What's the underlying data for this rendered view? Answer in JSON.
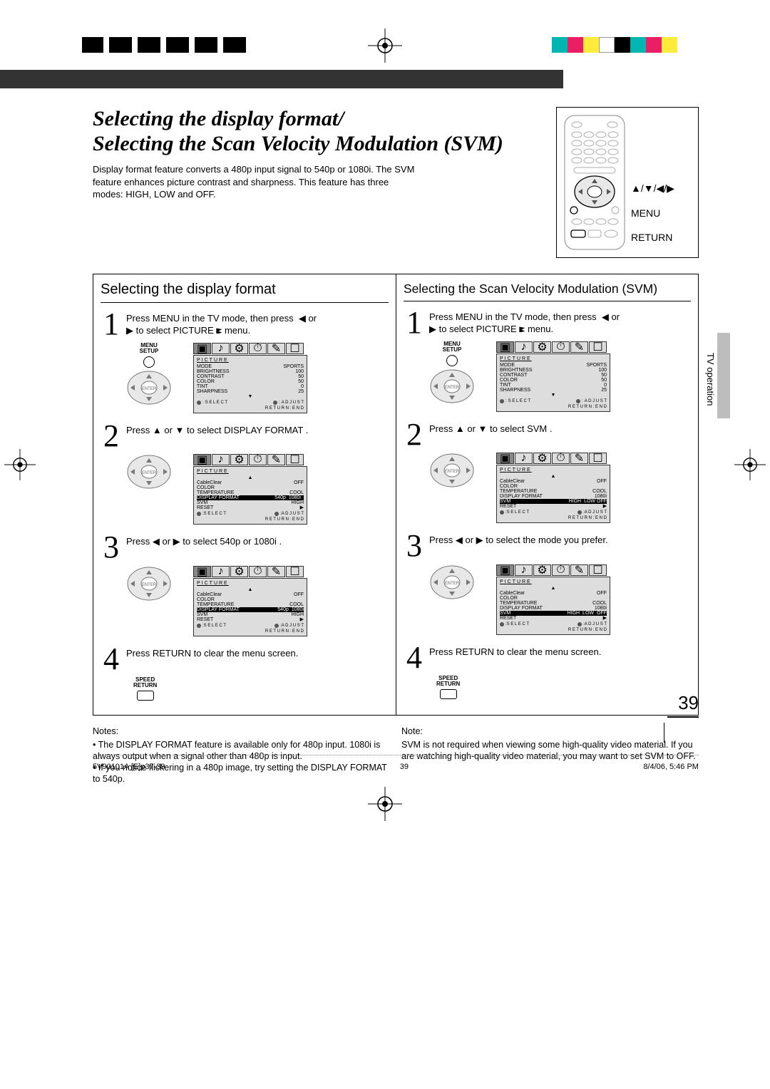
{
  "title_line1": "Selecting the display format/",
  "title_line2": "Selecting the Scan Velocity Modulation (SVM)",
  "intro": "Display format feature converts a 480p input signal to 540p or 1080i. The SVM feature enhances picture contrast and sharpness. This feature has three modes: HIGH, LOW and OFF.",
  "remote": {
    "arrows_label": "▲/▼/◀/▶",
    "menu_label": "MENU",
    "return_label": "RETURN"
  },
  "side_tab": "TV operation",
  "page_number": "39",
  "footer": {
    "left": "5V90101A [E]p37-39",
    "mid": "39",
    "right": "8/4/06, 5:46 PM"
  },
  "left_col": {
    "heading": "Selecting the display format",
    "step1_a": "Press MENU in the TV mode, then press",
    "step1_b": "or",
    "step1_c": "to select PICTURE",
    "step1_d": "menu.",
    "step1_nav": "◀",
    "step1_nav2": "▶",
    "step2_a": "Press",
    "step2_mid": "or",
    "step2_b": "to select  DISPLAY FORMAT .",
    "step2_up": "▲",
    "step2_dn": "▼",
    "step3_a": "Press",
    "step3_mid": "or",
    "step3_b": "to select  540p  or  1080i .",
    "step3_l": "◀",
    "step3_r": "▶",
    "step4": "Press RETURN to clear the menu screen.",
    "notes_hdr": "Notes:",
    "note1": "The DISPLAY FORMAT feature is available only for 480p input. 1080i is always output when a signal other than 480p is input.",
    "note2": "If you notice flickering in a 480p image, try setting the DISPLAY FORMAT to 540p.",
    "menu_setup": "MENU\nSETUP",
    "speed_return": "SPEED\nRETURN"
  },
  "right_col": {
    "heading": "Selecting the Scan Velocity Modulation (SVM)",
    "step1_a": "Press MENU in the TV mode, then press",
    "step1_b": "or",
    "step1_c": "to select PICTURE",
    "step1_d": "menu.",
    "step1_nav": "◀",
    "step1_nav2": "▶",
    "step2_a": "Press",
    "step2_mid": "or",
    "step2_b": "to select  SVM .",
    "step2_up": "▲",
    "step2_dn": "▼",
    "step3_a": "Press",
    "step3_mid": "or",
    "step3_b": "to select the mode you prefer.",
    "step3_l": "◀",
    "step3_r": "▶",
    "step4": "Press RETURN to clear the menu screen.",
    "notes_hdr": "Note:",
    "note1": "SVM is not required when viewing some high-quality video material. If you are watching high-quality video material, you may want to set SVM to OFF.",
    "menu_setup": "MENU\nSETUP",
    "speed_return": "SPEED\nRETURN"
  },
  "osd1": {
    "header": "PICTURE",
    "rows": [
      {
        "l": "MODE",
        "r": "SPORTS"
      },
      {
        "l": "BRIGHTNESS",
        "r": "100"
      },
      {
        "l": "CONTRAST",
        "r": "50"
      },
      {
        "l": "COLOR",
        "r": "50"
      },
      {
        "l": "TINT",
        "r": "0"
      },
      {
        "l": "SHARPNESS",
        "r": "25"
      }
    ],
    "more": "▼",
    "foot_sel": "S E L E C T",
    "foot_adj": "A D J U S T",
    "foot_ret": "R E T U R N : E N D"
  },
  "osd2_left": {
    "header": "PICTURE",
    "top": "▲",
    "rows": [
      {
        "l": "CableClear",
        "r": "OFF"
      },
      {
        "l": "COLOR",
        "r": ""
      },
      {
        "l": "TEMPERATURE",
        "r": "COOL"
      }
    ],
    "hl": {
      "l": "DISPLAY FORMAT",
      "opts": [
        "540p",
        "1080i"
      ]
    },
    "tail": [
      {
        "l": "SVM",
        "r": "HIGH"
      },
      {
        "l": "RESET",
        "r": "▶"
      }
    ]
  },
  "osd2_right": {
    "header": "PICTURE",
    "top": "▲",
    "rows": [
      {
        "l": "CableClear",
        "r": "OFF"
      },
      {
        "l": "COLOR",
        "r": ""
      },
      {
        "l": "TEMPERATURE",
        "r": "COOL"
      },
      {
        "l": "DISPLAY FORMAT",
        "r": "1080i"
      }
    ],
    "hl": {
      "l": "SVM",
      "opts": [
        "HIGH",
        "LOW",
        "OFF"
      ]
    },
    "tail": [
      {
        "l": "RESET",
        "r": "▶"
      }
    ]
  },
  "osd3_left": {
    "header": "PICTURE",
    "top": "▲",
    "rows": [
      {
        "l": "CableClear",
        "r": "OFF"
      },
      {
        "l": "COLOR",
        "r": ""
      },
      {
        "l": "TEMPERATURE",
        "r": "COOL"
      }
    ],
    "hl": {
      "l": "DISPLAY FORMAT",
      "opts": [
        "540p",
        "1080i"
      ]
    },
    "tail": [
      {
        "l": "SVM",
        "r": "HIGH"
      },
      {
        "l": "RESET",
        "r": "▶"
      }
    ]
  },
  "osd3_right": {
    "header": "PICTURE",
    "top": "▲",
    "rows": [
      {
        "l": "CableClear",
        "r": "OFF"
      },
      {
        "l": "COLOR",
        "r": ""
      },
      {
        "l": "TEMPERATURE",
        "r": "COOL"
      },
      {
        "l": "DISPLAY FORMAT",
        "r": "1080i"
      }
    ],
    "hl": {
      "l": "SVM",
      "opts": [
        "HIGH",
        "LOW",
        "OFF"
      ]
    },
    "tail": [
      {
        "l": "RESET",
        "r": "▶"
      }
    ]
  },
  "colors": {
    "swatches": [
      "#00b6b0",
      "#e91e63",
      "#ffeb3b",
      "#ffffff",
      "#000000",
      "#00b6b0",
      "#e91e63",
      "#ffeb3b"
    ]
  }
}
